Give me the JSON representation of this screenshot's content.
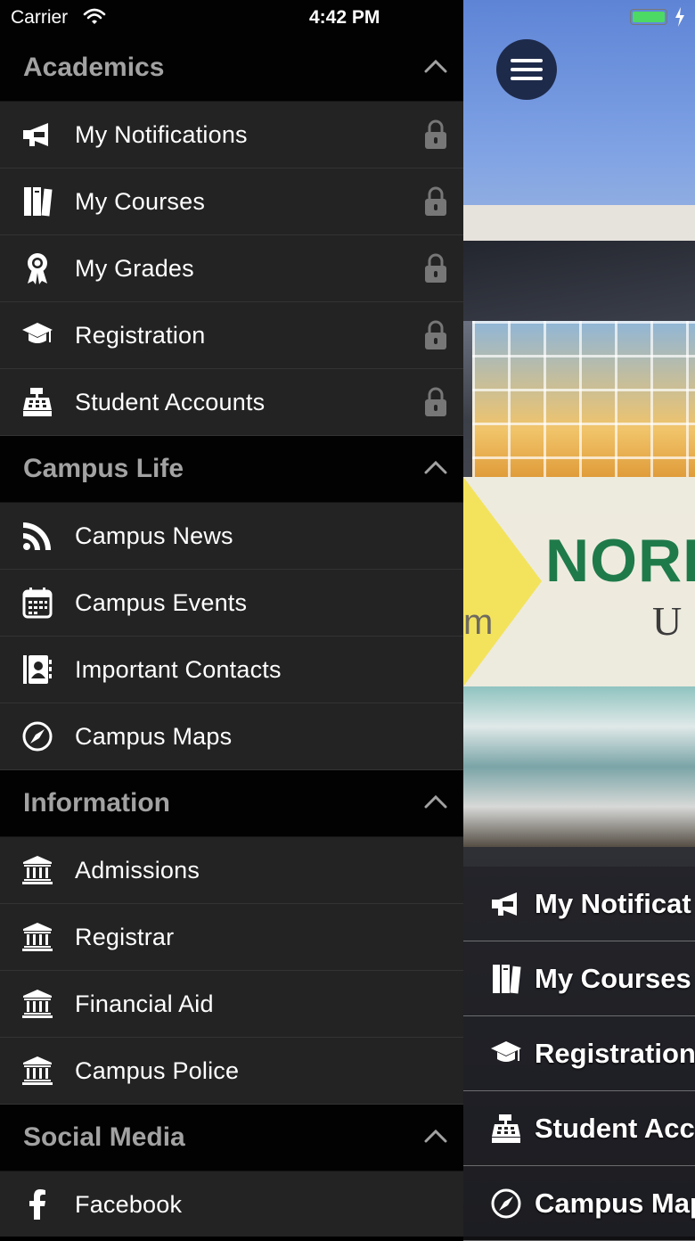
{
  "status_bar": {
    "carrier": "Carrier",
    "time": "4:42 PM"
  },
  "colors": {
    "drawer_bg": "#232323",
    "header_bg": "#020202",
    "header_text": "#a2a2a2",
    "battery": "#4cd964",
    "menu_button": "#1e2a4a",
    "banner_green": "#1f7a4a"
  },
  "background": {
    "banner_name": "NORI",
    "banner_sub": "U",
    "banner_left_text": "m"
  },
  "menu_button": {
    "icon": "hamburger-icon"
  },
  "drawer": {
    "sections": [
      {
        "title": "Academics",
        "items": [
          {
            "label": "My Notifications",
            "icon": "megaphone-icon",
            "locked": true
          },
          {
            "label": "My Courses",
            "icon": "books-icon",
            "locked": true
          },
          {
            "label": "My Grades",
            "icon": "award-icon",
            "locked": true
          },
          {
            "label": "Registration",
            "icon": "graduation-cap-icon",
            "locked": true
          },
          {
            "label": "Student Accounts",
            "icon": "cash-register-icon",
            "locked": true
          }
        ]
      },
      {
        "title": "Campus Life",
        "items": [
          {
            "label": "Campus News",
            "icon": "rss-icon"
          },
          {
            "label": "Campus Events",
            "icon": "calendar-icon"
          },
          {
            "label": "Important Contacts",
            "icon": "address-book-icon"
          },
          {
            "label": "Campus Maps",
            "icon": "compass-icon"
          }
        ]
      },
      {
        "title": "Information",
        "items": [
          {
            "label": "Admissions",
            "icon": "institution-icon"
          },
          {
            "label": "Registrar",
            "icon": "institution-icon"
          },
          {
            "label": "Financial Aid",
            "icon": "institution-icon"
          },
          {
            "label": "Campus Police",
            "icon": "institution-icon"
          }
        ]
      },
      {
        "title": "Social Media",
        "items": [
          {
            "label": "Facebook",
            "icon": "facebook-icon"
          }
        ]
      }
    ]
  },
  "quick_links": [
    {
      "label": "My Notificat",
      "icon": "megaphone-icon"
    },
    {
      "label": "My Courses",
      "icon": "books-icon"
    },
    {
      "label": "Registration",
      "icon": "graduation-cap-icon"
    },
    {
      "label": "Student Acc",
      "icon": "cash-register-icon"
    },
    {
      "label": "Campus Map",
      "icon": "compass-icon"
    }
  ]
}
